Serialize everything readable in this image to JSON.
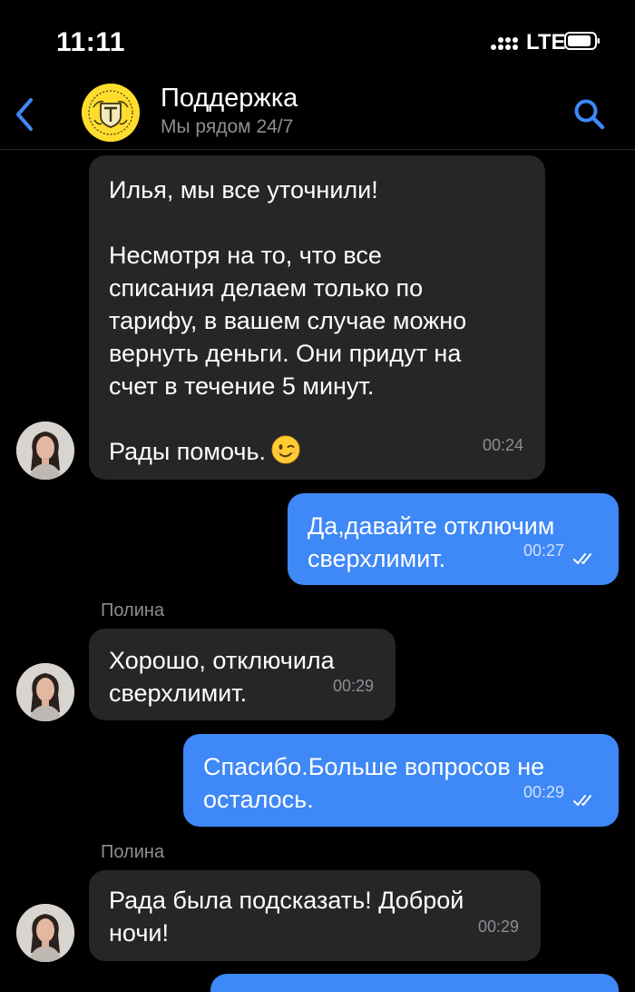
{
  "status_bar": {
    "time": "11:11",
    "network": "LTE"
  },
  "header": {
    "title": "Поддержка",
    "subtitle": "Мы рядом 24/7",
    "back_icon": "chevron-left-icon",
    "search_icon": "search-icon"
  },
  "messages": [
    {
      "direction": "incoming",
      "paragraphs": [
        "Илья, мы все уточнили!",
        "Несмотря на то, что все\nсписания делаем только по\nтарифу, в вашем случае можно\nвернуть деньги. Они придут на\nсчет в течение 5 минут.",
        "Рады помочь."
      ],
      "emoji": "winking-face",
      "time": "00:24"
    },
    {
      "direction": "outgoing",
      "text": "Да,давайте отключим\nсверхлимит.",
      "time": "00:27",
      "status": "read"
    },
    {
      "direction": "incoming",
      "sender": "Полина",
      "text": "Хорошо, отключила\nсверхлимит.",
      "time": "00:29"
    },
    {
      "direction": "outgoing",
      "text": "Спасибо.Больше вопросов не\nосталось.",
      "time": "00:29",
      "status": "read"
    },
    {
      "direction": "incoming",
      "sender": "Полина",
      "text": "Рада была подсказать! Доброй\nночи!",
      "time": "00:29"
    }
  ],
  "colors": {
    "background": "#000000",
    "incoming_bubble": "#262628",
    "outgoing_bubble": "#3e88f7",
    "accent": "#3e88f7",
    "logo": "#ffdd2d"
  }
}
